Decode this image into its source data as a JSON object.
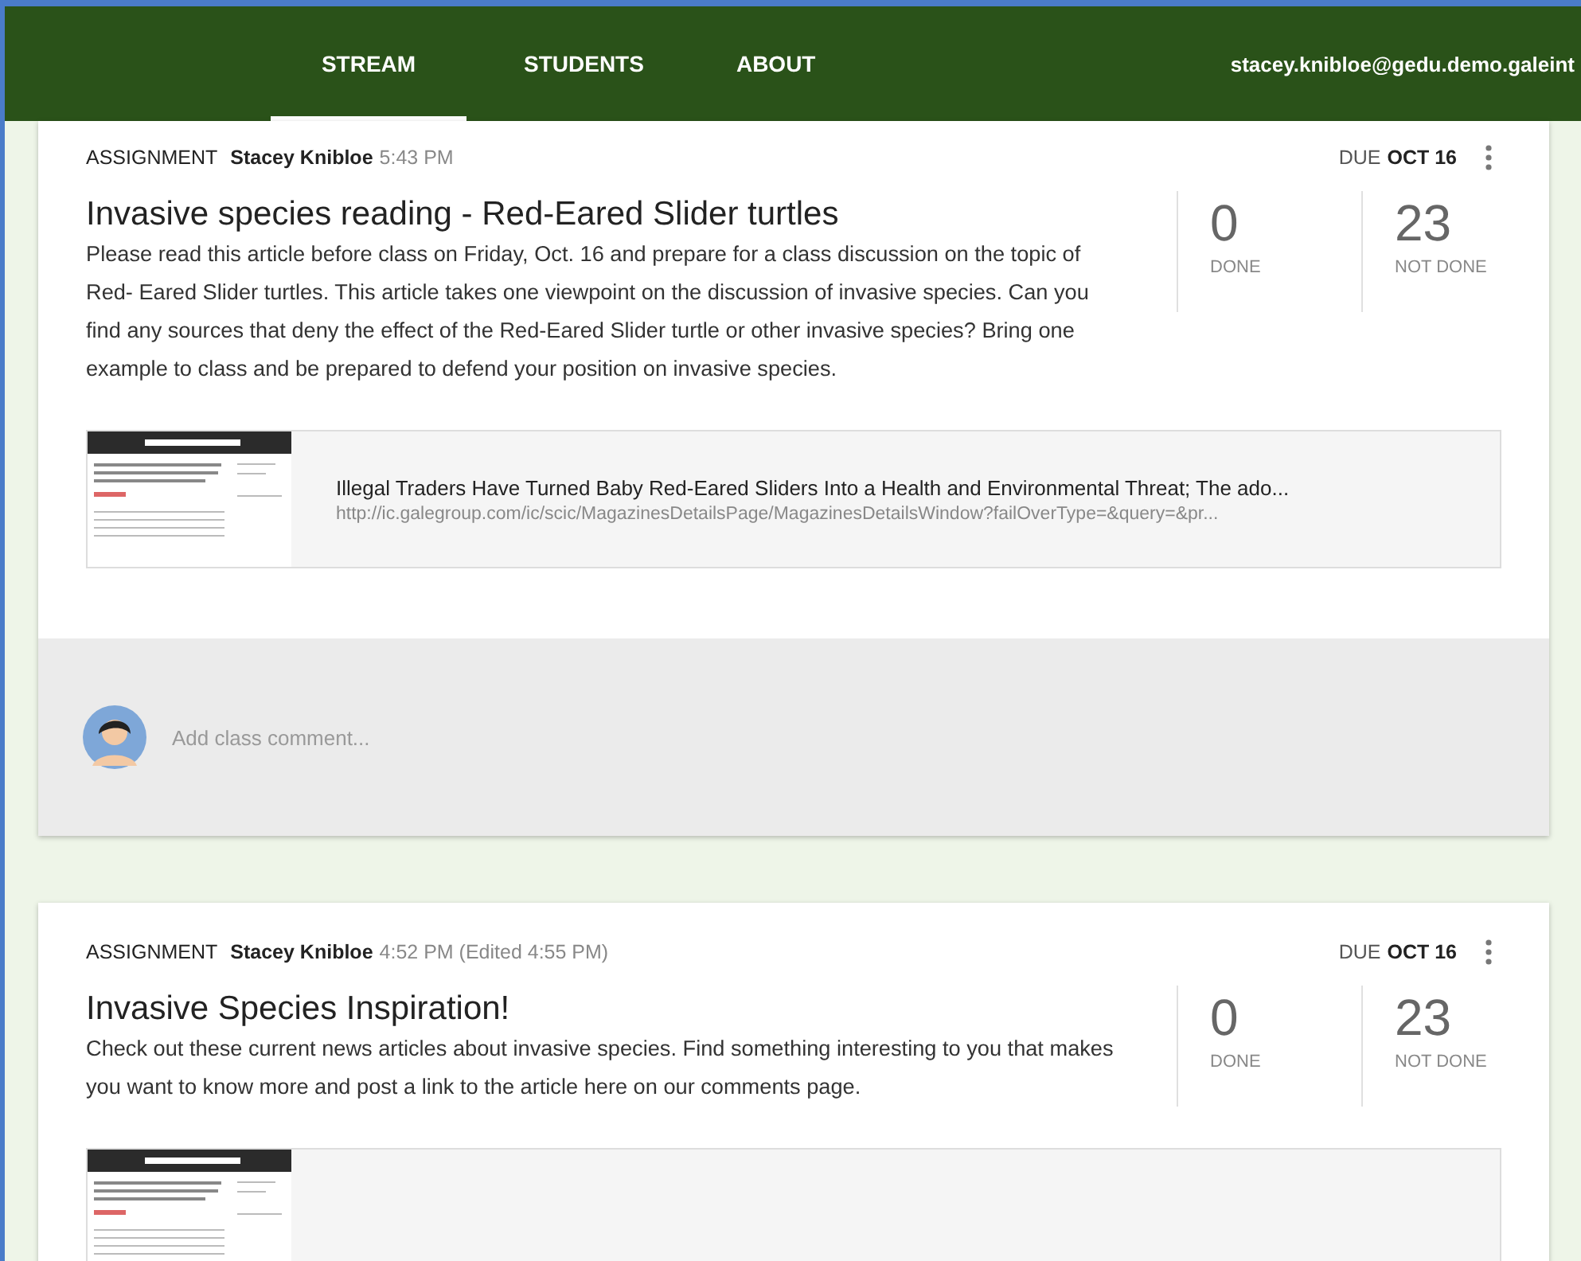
{
  "header": {
    "tabs": [
      {
        "label": "STREAM",
        "selected": true
      },
      {
        "label": "STUDENTS",
        "selected": false
      },
      {
        "label": "ABOUT",
        "selected": false
      }
    ],
    "account": "stacey.knibloe@gedu.demo.galeint"
  },
  "posts": [
    {
      "type": "ASSIGNMENT",
      "author": "Stacey Knibloe",
      "time": "5:43 PM",
      "due_label": "DUE",
      "due_date": "OCT 16",
      "title": "Invasive species reading - Red-Eared Slider turtles",
      "body": "Please read this article before class on Friday, Oct. 16 and prepare for a class discussion on the topic of Red- Eared Slider turtles. This article takes one viewpoint on the discussion of invasive species. Can you find any sources that deny the effect of the Red-Eared Slider turtle or other invasive species? Bring one example to class and be prepared to defend your position on invasive species.",
      "done": "0",
      "done_label": "DONE",
      "not_done": "23",
      "not_done_label": "NOT DONE",
      "attachment": {
        "kind": "link",
        "title": "Illegal Traders Have Turned Baby Red-Eared Sliders Into a Health and Environmental Threat; The ado...",
        "url": "http://ic.galegroup.com/ic/scic/MagazinesDetailsPage/MagazinesDetailsWindow?failOverType=&query=&pr..."
      },
      "comment_placeholder": "Add class comment..."
    },
    {
      "type": "ASSIGNMENT",
      "author": "Stacey Knibloe",
      "time": "4:52 PM (Edited 4:55 PM)",
      "due_label": "DUE",
      "due_date": "OCT 16",
      "title": "Invasive Species Inspiration!",
      "body": "Check out these current news articles about invasive species. Find something interesting to you that makes you want to know more and post a link to the article here on our comments page.",
      "done": "0",
      "done_label": "DONE",
      "not_done": "23",
      "not_done_label": "NOT DONE",
      "attachment": {
        "kind": "thumbnail"
      }
    }
  ]
}
